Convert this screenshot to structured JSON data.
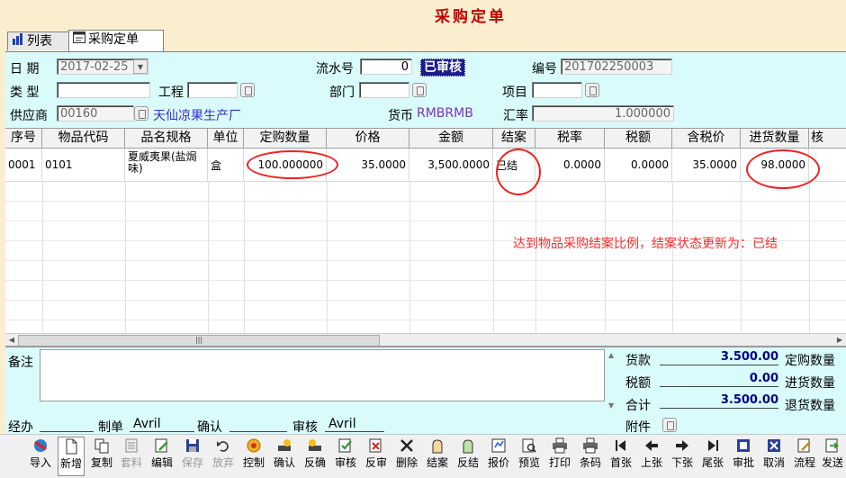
{
  "window": {
    "title": "采购定单"
  },
  "tabs": [
    {
      "label": "列表"
    },
    {
      "label": "采购定单"
    }
  ],
  "form": {
    "date_label": "日  期",
    "date_value": "2017-02-25",
    "serial_label": "流水号",
    "serial_value": "0",
    "status_badge": "已审核",
    "number_label": "编号",
    "number_value": "201702250003",
    "type_label": "类  型",
    "type_value": "",
    "project_label": "工程",
    "project_value": "",
    "dept_label": "部门",
    "dept_value": "",
    "item_label": "项目",
    "item_value": "",
    "supplier_label": "供应商",
    "supplier_code": "00160",
    "supplier_name": "天仙凉果生产厂",
    "currency_label": "货币",
    "currency_value": "RMBRMB",
    "rate_label": "汇率",
    "rate_value": "1.000000"
  },
  "grid": {
    "columns": [
      "序号",
      "物品代码",
      "品名规格",
      "单位",
      "定购数量",
      "价格",
      "金额",
      "结案",
      "税率",
      "税额",
      "含税价",
      "进货数量",
      "核"
    ],
    "rows": [
      [
        "0001",
        "0101",
        "夏威夷果(盐焗味)",
        "盒",
        "100.000000",
        "35.0000",
        "3,500.0000",
        "已结",
        "0.0000",
        "0.0000",
        "35.0000",
        "98.0000",
        ""
      ]
    ],
    "annotation": "达到物品采购结案比例，结案状态更新为：已结"
  },
  "bottom": {
    "remark_label": "备注",
    "goods_label": "货款",
    "goods_value": "3.500.00",
    "tax_label": "税额",
    "tax_value": "0.00",
    "total_label": "合计",
    "total_value": "3.500.00",
    "order_qty_label": "定购数量",
    "received_qty_label": "进货数量",
    "returned_qty_label": "退货数量",
    "attachment_label": "附件",
    "handler_label": "经办",
    "handler_value": "",
    "maker_label": "制单",
    "maker_value": "Avril",
    "confirm_label": "确认",
    "confirm_value": "",
    "auditor_label": "审核",
    "auditor_value": "Avril"
  },
  "toolbar": [
    {
      "label": "导入",
      "icon": "import-icon"
    },
    {
      "label": "新增",
      "icon": "new-document-icon"
    },
    {
      "label": "复制",
      "icon": "copy-icon"
    },
    {
      "label": "套料",
      "icon": "material-icon"
    },
    {
      "label": "编辑",
      "icon": "edit-icon"
    },
    {
      "label": "保存",
      "icon": "save-icon"
    },
    {
      "label": "放弃",
      "icon": "undo-icon"
    },
    {
      "label": "控制",
      "icon": "control-icon"
    },
    {
      "label": "确认",
      "icon": "confirm-icon"
    },
    {
      "label": "反确",
      "icon": "unconfirm-icon"
    },
    {
      "label": "审核",
      "icon": "audit-icon"
    },
    {
      "label": "反审",
      "icon": "unaudit-icon"
    },
    {
      "label": "删除",
      "icon": "delete-icon"
    },
    {
      "label": "结案",
      "icon": "close-case-icon"
    },
    {
      "label": "反结",
      "icon": "reopen-case-icon"
    },
    {
      "label": "报价",
      "icon": "quote-icon"
    },
    {
      "label": "预览",
      "icon": "preview-icon"
    },
    {
      "label": "打印",
      "icon": "print-icon"
    },
    {
      "label": "条码",
      "icon": "barcode-icon"
    },
    {
      "label": "首张",
      "icon": "first-icon"
    },
    {
      "label": "上张",
      "icon": "prev-icon"
    },
    {
      "label": "下张",
      "icon": "next-icon"
    },
    {
      "label": "尾张",
      "icon": "last-icon"
    },
    {
      "label": "审批",
      "icon": "approval-icon"
    },
    {
      "label": "取消",
      "icon": "cancel-icon"
    },
    {
      "label": "流程",
      "icon": "workflow-icon"
    },
    {
      "label": "发送",
      "icon": "send-icon"
    }
  ],
  "colors": {
    "form_bg": "#d9fbfc",
    "page_bg": "#fbeecf",
    "title": "#c00000",
    "annotation": "#ff2a2a",
    "badge_bg": "#1b1b8f"
  }
}
